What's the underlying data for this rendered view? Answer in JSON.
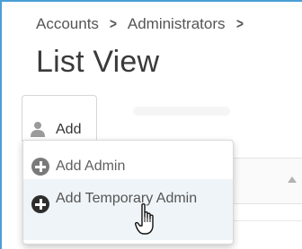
{
  "breadcrumb": {
    "items": [
      "Accounts",
      "Administrators"
    ],
    "separator": ">"
  },
  "page": {
    "title": "List View"
  },
  "toolbar": {
    "add_label": "Add",
    "add_icon": "user-icon"
  },
  "add_menu": {
    "items": [
      {
        "label": "Add Admin",
        "icon": "plus-circle-icon",
        "hovered": false
      },
      {
        "label": "Add Temporary Admin",
        "icon": "plus-circle-icon",
        "hovered": true
      }
    ]
  },
  "table": {
    "sort_icon": "sort-up-icon"
  },
  "colors": {
    "frame_border": "#4a9fd6",
    "hover_background": "#eef4f8",
    "text": "#333333"
  }
}
